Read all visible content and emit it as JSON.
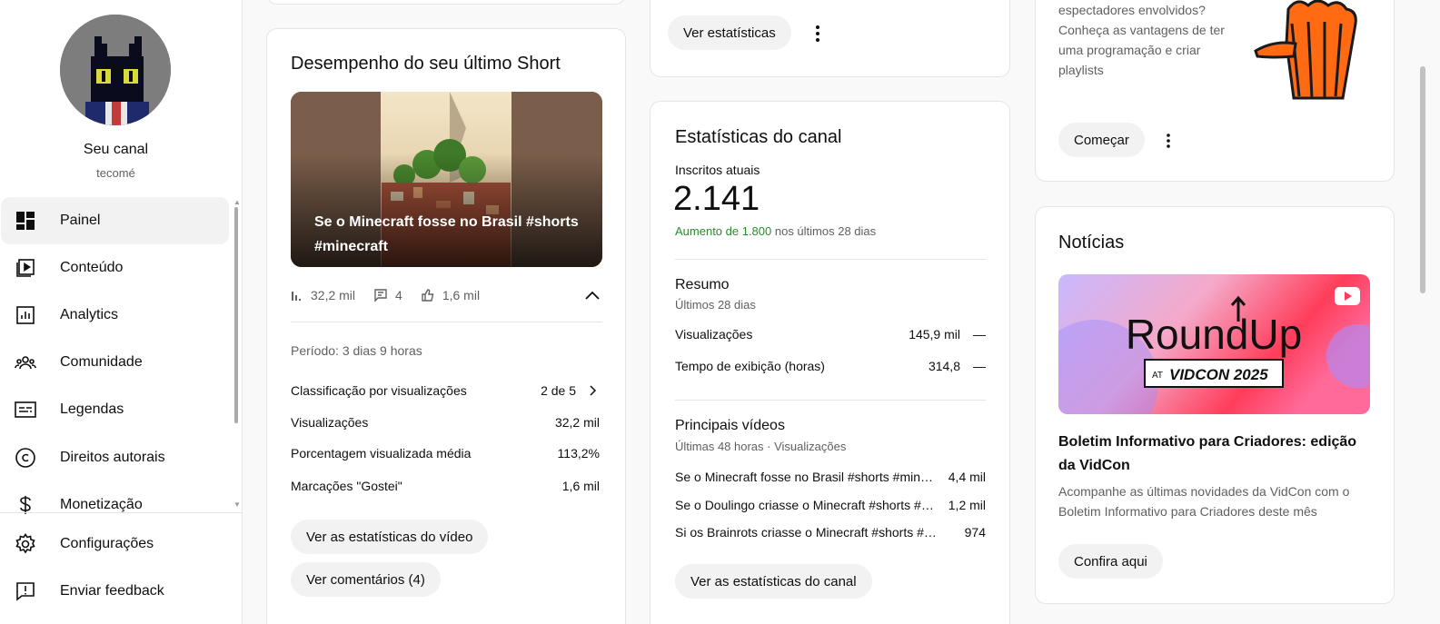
{
  "sidebar": {
    "channel_name": "Seu canal",
    "channel_handle": "tecomé",
    "items": [
      {
        "label": "Painel",
        "icon": "dashboard-icon"
      },
      {
        "label": "Conteúdo",
        "icon": "content-icon"
      },
      {
        "label": "Analytics",
        "icon": "analytics-icon"
      },
      {
        "label": "Comunidade",
        "icon": "community-icon"
      },
      {
        "label": "Legendas",
        "icon": "subtitles-icon"
      },
      {
        "label": "Direitos autorais",
        "icon": "copyright-icon"
      },
      {
        "label": "Monetização",
        "icon": "monetization-icon"
      }
    ],
    "footer_items": [
      {
        "label": "Configurações",
        "icon": "gear-icon"
      },
      {
        "label": "Enviar feedback",
        "icon": "feedback-icon"
      }
    ]
  },
  "last_short": {
    "title": "Desempenho do seu último Short",
    "thumbnail_title": "Se o Minecraft fosse no Brasil #shorts #minecraft",
    "views": "32,2 mil",
    "comments": "4",
    "likes": "1,6 mil",
    "period": "Período: 3 dias 9 horas",
    "stats": [
      {
        "label": "Classificação por visualizações",
        "value": "2 de 5"
      },
      {
        "label": "Visualizações",
        "value": "32,2 mil"
      },
      {
        "label": "Porcentagem visualizada média",
        "value": "113,2%"
      },
      {
        "label": "Marcações \"Gostei\"",
        "value": "1,6 mil"
      }
    ],
    "video_stats_button": "Ver as estatísticas do vídeo",
    "comments_button": "Ver comentários (4)"
  },
  "top_card": {
    "button": "Ver estatísticas"
  },
  "channel_stats": {
    "title": "Estatísticas do canal",
    "subscribers_label": "Inscritos atuais",
    "subscribers": "2.141",
    "growth_highlight": "Aumento de 1.800",
    "growth_rest": " nos últimos 28 dias",
    "summary_title": "Resumo",
    "summary_sub": "Últimos 28 dias",
    "summary": [
      {
        "label": "Visualizações",
        "value": "145,9 mil",
        "delta": "—"
      },
      {
        "label": "Tempo de exibição (horas)",
        "value": "314,8",
        "delta": "—"
      }
    ],
    "top_videos_title": "Principais vídeos",
    "top_videos_sub": "Últimas 48 horas · Visualizações",
    "top_videos": [
      {
        "title": "Se o Minecraft fosse no Brasil #shorts #minecraft",
        "views": "4,4 mil"
      },
      {
        "title": "Se o Doulingo criasse o Minecraft #shorts #minecraft",
        "views": "1,2 mil"
      },
      {
        "title": "Si os Brainrots criasse o Minecraft #shorts #minecraft",
        "views": "974"
      }
    ],
    "button": "Ver as estatísticas do canal"
  },
  "promo": {
    "text_lines": [
      "espectadores envolvidos?",
      "Conheça as vantagens de ter",
      "uma programação e criar",
      "playlists"
    ],
    "button": "Começar"
  },
  "news": {
    "title": "Notícias",
    "image_text_main": "RoundUp",
    "image_text_at": "AT",
    "image_text_event": "VIDCON 2025",
    "headline": "Boletim Informativo para Criadores: edição da VidCon",
    "description": "Acompanhe as últimas novidades da VidCon com o Boletim Informativo para Criadores deste mês",
    "button": "Confira aqui"
  },
  "colors": {
    "accent_green": "#2c8a2f",
    "pill_bg": "#f2f2f2",
    "promo_orange": "#ff6a13"
  }
}
